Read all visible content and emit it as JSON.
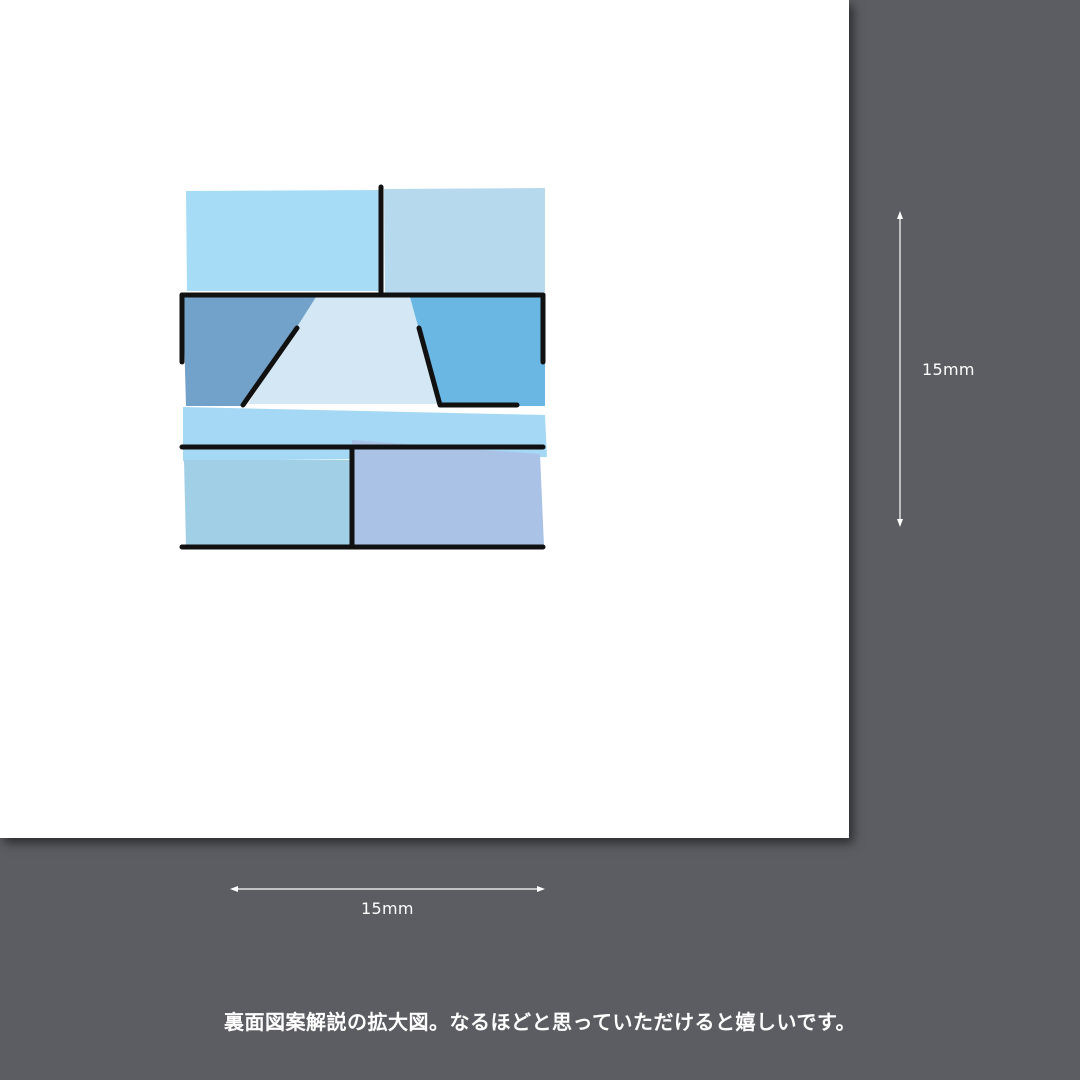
{
  "dimensions": {
    "width_label": "15mm",
    "height_label": "15mm"
  },
  "caption": "裏面図案解説の拡大図。なるほどと思っていただけると嬉しいです。",
  "colors": {
    "background": "#5c5d62",
    "paper": "#ffffff",
    "line": "#111111",
    "light_blue": "#a6dcf5",
    "pale_blue": "#b7d9ee",
    "steel_blue": "#72a2c9",
    "sky_blue": "#6ab7e3",
    "ice_blue": "#d3e8f4",
    "band_blue": "#a5d8f4",
    "soft_blue": "#a1cfe6",
    "periwinkle": "#a9c2e6"
  }
}
